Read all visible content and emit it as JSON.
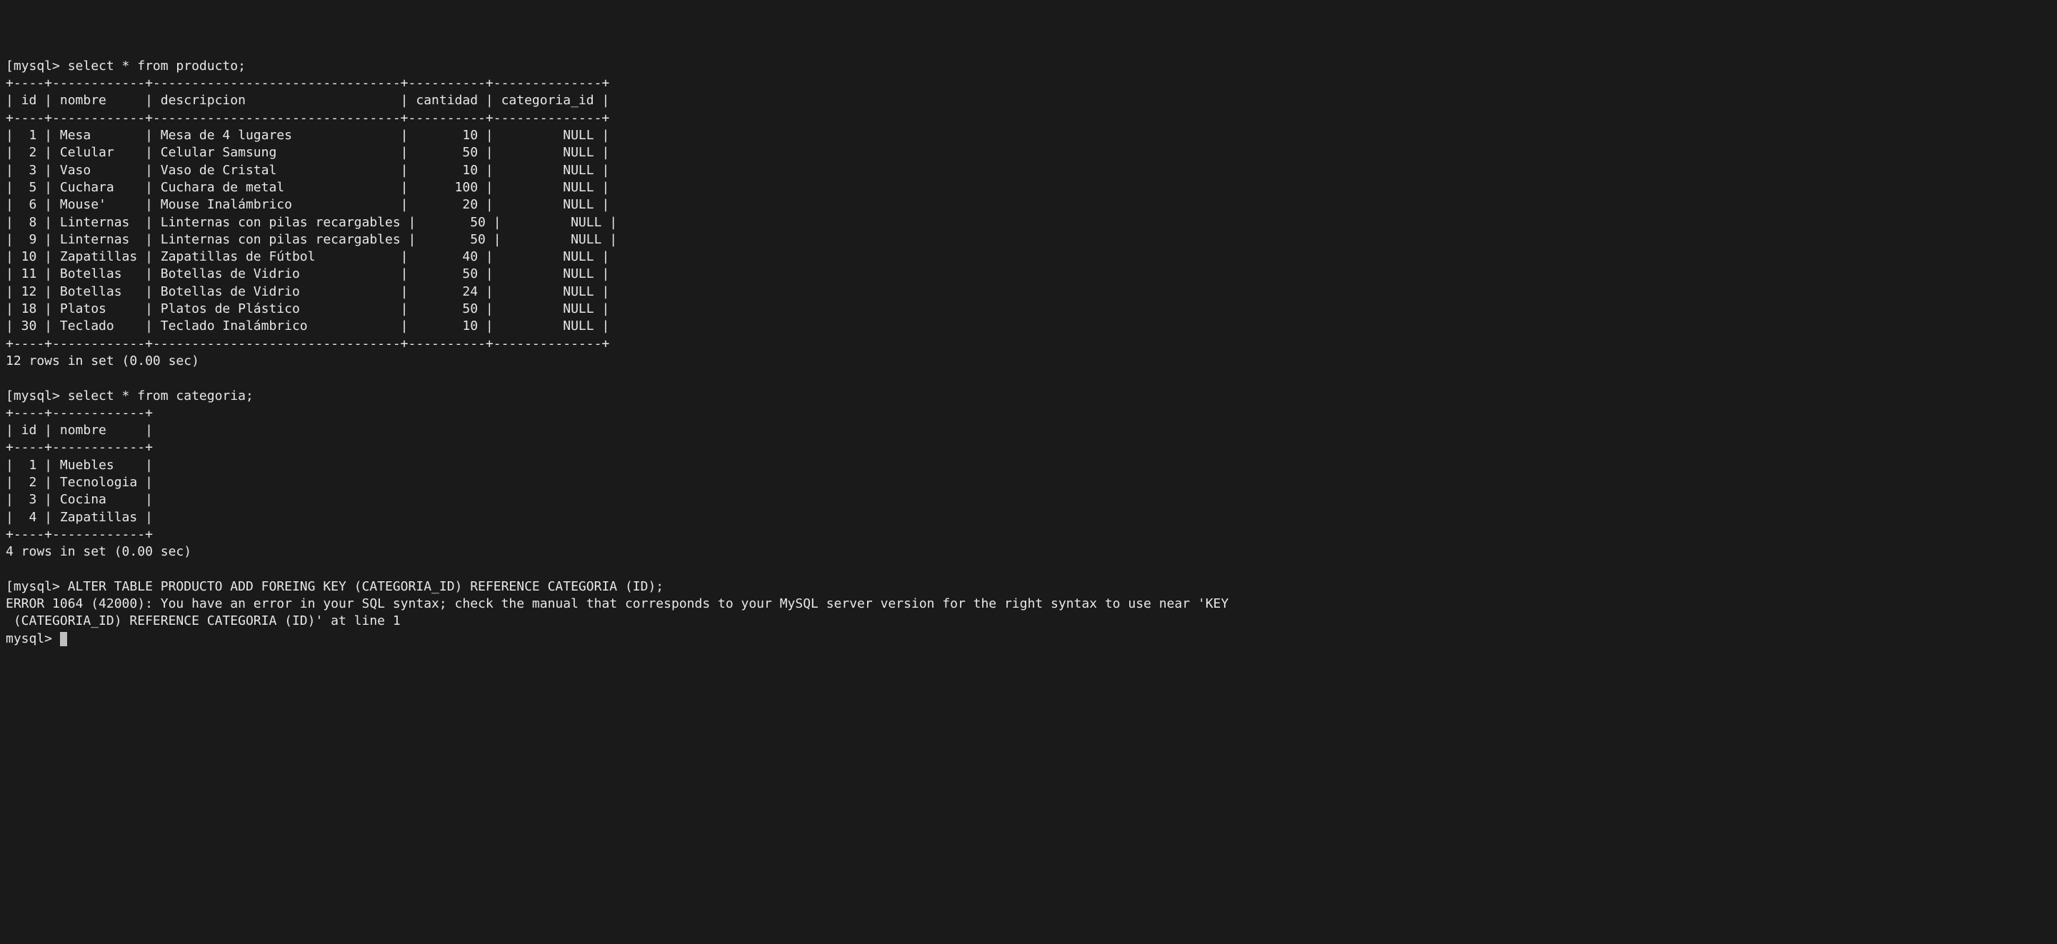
{
  "prompt": "mysql>",
  "producto": {
    "query": "select * from producto;",
    "columns": [
      "id",
      "nombre",
      "descripcion",
      "cantidad",
      "categoria_id"
    ],
    "rows": [
      {
        "id": 1,
        "nombre": "Mesa",
        "descripcion": "Mesa de 4 lugares",
        "cantidad": 10,
        "categoria_id": "NULL"
      },
      {
        "id": 2,
        "nombre": "Celular",
        "descripcion": "Celular Samsung",
        "cantidad": 50,
        "categoria_id": "NULL"
      },
      {
        "id": 3,
        "nombre": "Vaso",
        "descripcion": "Vaso de Cristal",
        "cantidad": 10,
        "categoria_id": "NULL"
      },
      {
        "id": 5,
        "nombre": "Cuchara",
        "descripcion": "Cuchara de metal",
        "cantidad": 100,
        "categoria_id": "NULL"
      },
      {
        "id": 6,
        "nombre": "Mouse'",
        "descripcion": "Mouse Inalámbrico",
        "cantidad": 20,
        "categoria_id": "NULL"
      },
      {
        "id": 8,
        "nombre": "Linternas",
        "descripcion": "Linternas con pilas recargables",
        "cantidad": 50,
        "categoria_id": "NULL"
      },
      {
        "id": 9,
        "nombre": "Linternas",
        "descripcion": "Linternas con pilas recargables",
        "cantidad": 50,
        "categoria_id": "NULL"
      },
      {
        "id": 10,
        "nombre": "Zapatillas",
        "descripcion": "Zapatillas de Fútbol",
        "cantidad": 40,
        "categoria_id": "NULL"
      },
      {
        "id": 11,
        "nombre": "Botellas",
        "descripcion": "Botellas de Vidrio",
        "cantidad": 50,
        "categoria_id": "NULL"
      },
      {
        "id": 12,
        "nombre": "Botellas",
        "descripcion": "Botellas de Vidrio",
        "cantidad": 24,
        "categoria_id": "NULL"
      },
      {
        "id": 18,
        "nombre": "Platos",
        "descripcion": "Platos de Plástico",
        "cantidad": 50,
        "categoria_id": "NULL"
      },
      {
        "id": 30,
        "nombre": "Teclado",
        "descripcion": "Teclado Inalámbrico",
        "cantidad": 10,
        "categoria_id": "NULL"
      }
    ],
    "status": "12 rows in set (0.00 sec)"
  },
  "categoria": {
    "query": "select * from categoria;",
    "columns": [
      "id",
      "nombre"
    ],
    "rows": [
      {
        "id": 1,
        "nombre": "Muebles"
      },
      {
        "id": 2,
        "nombre": "Tecnologia"
      },
      {
        "id": 3,
        "nombre": "Cocina"
      },
      {
        "id": 4,
        "nombre": "Zapatillas"
      }
    ],
    "status": "4 rows in set (0.00 sec)"
  },
  "alter": {
    "query": "ALTER TABLE PRODUCTO ADD FOREING KEY (CATEGORIA_ID) REFERENCE CATEGORIA (ID);",
    "error": "ERROR 1064 (42000): You have an error in your SQL syntax; check the manual that corresponds to your MySQL server version for the right syntax to use near 'KEY\n (CATEGORIA_ID) REFERENCE CATEGORIA (ID)' at line 1"
  }
}
